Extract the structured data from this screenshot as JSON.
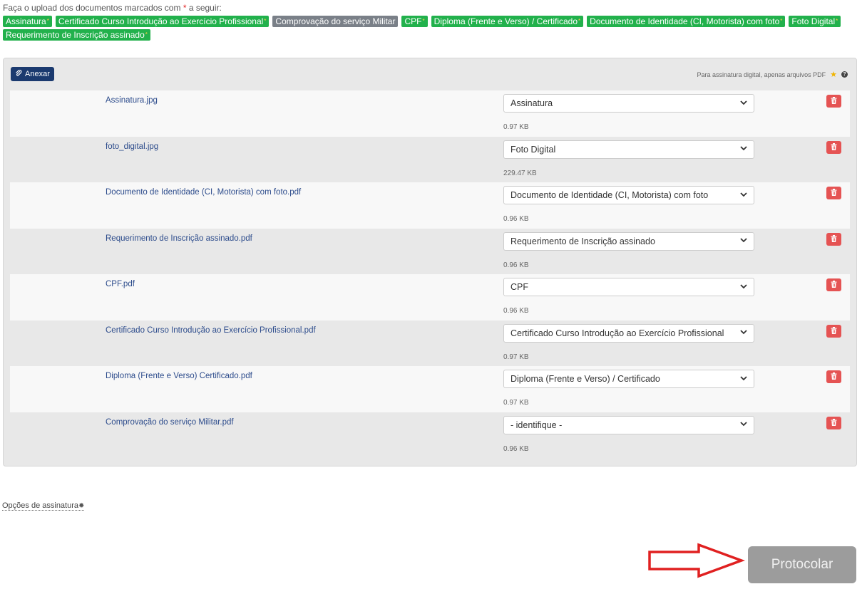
{
  "intro": {
    "prefix": "Faça o upload dos documentos marcados com",
    "asterisk": "*",
    "suffix": "a seguir:"
  },
  "required_docs": [
    {
      "label": "Assinatura",
      "status": "done",
      "marked": true
    },
    {
      "label": "Certificado Curso Introdução ao Exercício Profissional",
      "status": "done",
      "marked": true
    },
    {
      "label": "Comprovação do serviço Militar",
      "status": "pending",
      "marked": false
    },
    {
      "label": "CPF",
      "status": "done",
      "marked": true
    },
    {
      "label": "Diploma (Frente e Verso) / Certificado",
      "status": "done",
      "marked": true
    },
    {
      "label": "Documento de Identidade (CI, Motorista) com foto",
      "status": "done",
      "marked": true
    },
    {
      "label": "Foto Digital",
      "status": "done",
      "marked": true
    },
    {
      "label": "Requerimento de Inscrição assinado",
      "status": "done",
      "marked": true
    }
  ],
  "panel": {
    "attach_label": "Anexar",
    "signature_note": "Para assinatura digital, apenas arquivos PDF",
    "files": [
      {
        "name": "Assinatura.jpg",
        "type": "Assinatura",
        "size": "0.97 KB"
      },
      {
        "name": "foto_digital.jpg",
        "type": "Foto Digital",
        "size": "229.47 KB"
      },
      {
        "name": "Documento de Identidade (CI, Motorista) com foto.pdf",
        "type": "Documento de Identidade (CI, Motorista) com foto",
        "size": "0.96 KB"
      },
      {
        "name": "Requerimento de Inscrição assinado.pdf",
        "type": "Requerimento de Inscrição assinado",
        "size": "0.96 KB"
      },
      {
        "name": "CPF.pdf",
        "type": "CPF",
        "size": "0.96 KB"
      },
      {
        "name": "Certificado Curso Introdução ao Exercício Profissional.pdf",
        "type": "Certificado Curso Introdução ao Exercício Profissional",
        "size": "0.97 KB"
      },
      {
        "name": "Diploma (Frente e Verso) Certificado.pdf",
        "type": "Diploma (Frente e Verso) / Certificado",
        "size": "0.97 KB"
      },
      {
        "name": "Comprovação do serviço Militar.pdf",
        "type": "- identifique -",
        "size": "0.96 KB"
      }
    ]
  },
  "signature_options_label": "Opções de assinatura",
  "submit_label": "Protocolar",
  "colors": {
    "tag_done": "#22b14c",
    "tag_pending": "#7a8088",
    "attach": "#1b3a6f",
    "delete": "#e55353",
    "submit": "#9c9c9c",
    "arrow": "#e02020"
  }
}
